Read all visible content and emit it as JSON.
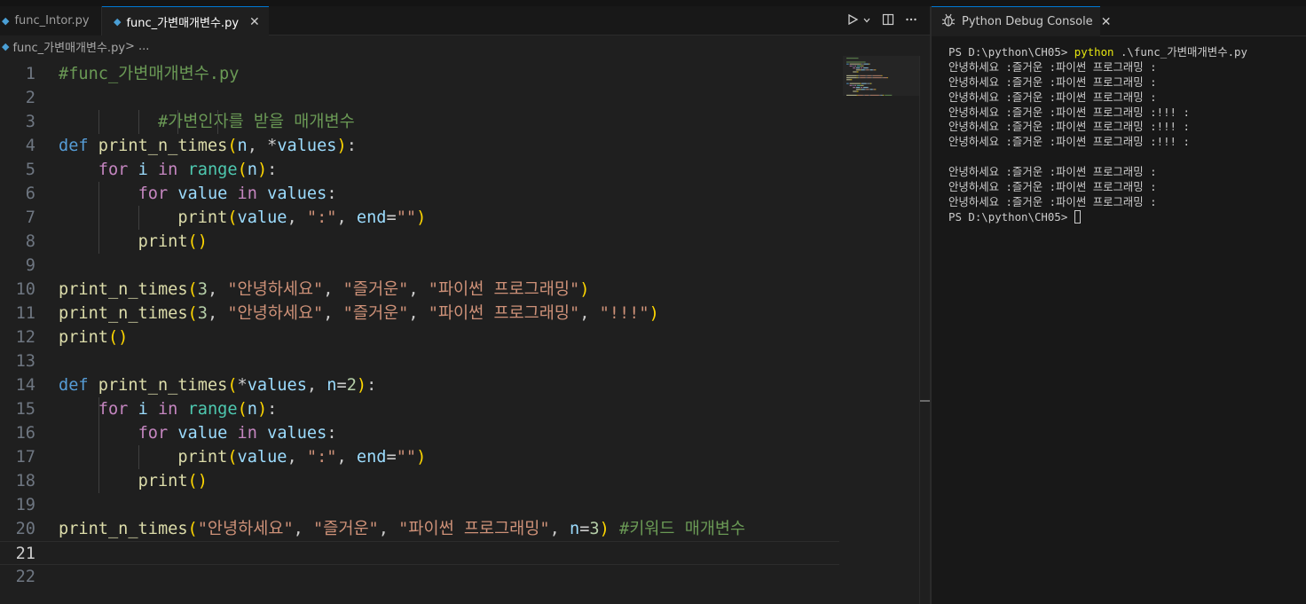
{
  "editor": {
    "tabs": [
      {
        "label": "func_Intor.py",
        "active": false
      },
      {
        "label": "func_가변매개변수.py",
        "active": true
      }
    ],
    "close_glyph": "✕",
    "breadcrumb": {
      "file": "func_가변매개변수.py",
      "rest": " > ..."
    },
    "actions": [
      "run-icon",
      "chevron-down-icon",
      "split-editor-icon",
      "more-icon"
    ],
    "active_line": 21,
    "lines": [
      [
        [
          "cmt",
          "#func_가변매개변수.py"
        ]
      ],
      [],
      [
        [
          "cmt",
          "          #가변인자를 받을 매개변수"
        ]
      ],
      [
        [
          "kw",
          "def"
        ],
        [
          "txt",
          " "
        ],
        [
          "fn",
          "print_n_times"
        ],
        [
          "p1",
          "("
        ],
        [
          "var",
          "n"
        ],
        [
          "txt",
          ", *"
        ],
        [
          "var",
          "values"
        ],
        [
          "p1",
          ")"
        ],
        [
          "txt",
          ":"
        ]
      ],
      [
        [
          "txt",
          "    "
        ],
        [
          "ctl",
          "for"
        ],
        [
          "txt",
          " "
        ],
        [
          "var",
          "i"
        ],
        [
          "txt",
          " "
        ],
        [
          "ctl",
          "in"
        ],
        [
          "txt",
          " "
        ],
        [
          "bi",
          "range"
        ],
        [
          "p1",
          "("
        ],
        [
          "var",
          "n"
        ],
        [
          "p1",
          ")"
        ],
        [
          "txt",
          ":"
        ]
      ],
      [
        [
          "txt",
          "        "
        ],
        [
          "ctl",
          "for"
        ],
        [
          "txt",
          " "
        ],
        [
          "var",
          "value"
        ],
        [
          "txt",
          " "
        ],
        [
          "ctl",
          "in"
        ],
        [
          "txt",
          " "
        ],
        [
          "var",
          "values"
        ],
        [
          "txt",
          ":"
        ]
      ],
      [
        [
          "txt",
          "            "
        ],
        [
          "fn",
          "print"
        ],
        [
          "p1",
          "("
        ],
        [
          "var",
          "value"
        ],
        [
          "txt",
          ", "
        ],
        [
          "str",
          "\":\""
        ],
        [
          "txt",
          ", "
        ],
        [
          "var",
          "end"
        ],
        [
          "txt",
          "="
        ],
        [
          "str",
          "\"\""
        ],
        [
          "p1",
          ")"
        ]
      ],
      [
        [
          "txt",
          "        "
        ],
        [
          "fn",
          "print"
        ],
        [
          "p1",
          "()"
        ]
      ],
      [],
      [
        [
          "fn",
          "print_n_times"
        ],
        [
          "p1",
          "("
        ],
        [
          "num",
          "3"
        ],
        [
          "txt",
          ", "
        ],
        [
          "str",
          "\"안녕하세요\""
        ],
        [
          "txt",
          ", "
        ],
        [
          "str",
          "\"즐거운\""
        ],
        [
          "txt",
          ", "
        ],
        [
          "str",
          "\"파이썬 프로그래밍\""
        ],
        [
          "p1",
          ")"
        ]
      ],
      [
        [
          "fn",
          "print_n_times"
        ],
        [
          "p1",
          "("
        ],
        [
          "num",
          "3"
        ],
        [
          "txt",
          ", "
        ],
        [
          "str",
          "\"안녕하세요\""
        ],
        [
          "txt",
          ", "
        ],
        [
          "str",
          "\"즐거운\""
        ],
        [
          "txt",
          ", "
        ],
        [
          "str",
          "\"파이썬 프로그래밍\""
        ],
        [
          "txt",
          ", "
        ],
        [
          "str",
          "\"!!!\""
        ],
        [
          "p1",
          ")"
        ]
      ],
      [
        [
          "fn",
          "print"
        ],
        [
          "p1",
          "()"
        ]
      ],
      [],
      [
        [
          "kw",
          "def"
        ],
        [
          "txt",
          " "
        ],
        [
          "fn",
          "print_n_times"
        ],
        [
          "p1",
          "("
        ],
        [
          "txt",
          "*"
        ],
        [
          "var",
          "values"
        ],
        [
          "txt",
          ", "
        ],
        [
          "var",
          "n"
        ],
        [
          "txt",
          "="
        ],
        [
          "num",
          "2"
        ],
        [
          "p1",
          ")"
        ],
        [
          "txt",
          ":"
        ]
      ],
      [
        [
          "txt",
          "    "
        ],
        [
          "ctl",
          "for"
        ],
        [
          "txt",
          " "
        ],
        [
          "var",
          "i"
        ],
        [
          "txt",
          " "
        ],
        [
          "ctl",
          "in"
        ],
        [
          "txt",
          " "
        ],
        [
          "bi",
          "range"
        ],
        [
          "p1",
          "("
        ],
        [
          "var",
          "n"
        ],
        [
          "p1",
          ")"
        ],
        [
          "txt",
          ":"
        ]
      ],
      [
        [
          "txt",
          "        "
        ],
        [
          "ctl",
          "for"
        ],
        [
          "txt",
          " "
        ],
        [
          "var",
          "value"
        ],
        [
          "txt",
          " "
        ],
        [
          "ctl",
          "in"
        ],
        [
          "txt",
          " "
        ],
        [
          "var",
          "values"
        ],
        [
          "txt",
          ":"
        ]
      ],
      [
        [
          "txt",
          "            "
        ],
        [
          "fn",
          "print"
        ],
        [
          "p1",
          "("
        ],
        [
          "var",
          "value"
        ],
        [
          "txt",
          ", "
        ],
        [
          "str",
          "\":\""
        ],
        [
          "txt",
          ", "
        ],
        [
          "var",
          "end"
        ],
        [
          "txt",
          "="
        ],
        [
          "str",
          "\"\""
        ],
        [
          "p1",
          ")"
        ]
      ],
      [
        [
          "txt",
          "        "
        ],
        [
          "fn",
          "print"
        ],
        [
          "p1",
          "()"
        ]
      ],
      [],
      [
        [
          "fn",
          "print_n_times"
        ],
        [
          "p1",
          "("
        ],
        [
          "str",
          "\"안녕하세요\""
        ],
        [
          "txt",
          ", "
        ],
        [
          "str",
          "\"즐거운\""
        ],
        [
          "txt",
          ", "
        ],
        [
          "str",
          "\"파이썬 프로그래밍\""
        ],
        [
          "txt",
          ", "
        ],
        [
          "var",
          "n"
        ],
        [
          "txt",
          "="
        ],
        [
          "num",
          "3"
        ],
        [
          "p1",
          ")"
        ],
        [
          "txt",
          " "
        ],
        [
          "cmt",
          "#키워드 매개변수"
        ]
      ],
      [],
      []
    ]
  },
  "console": {
    "tab_label": "Python Debug Console",
    "close_glyph": "✕",
    "prompt": "PS D:\\python\\CH05> ",
    "command": "python",
    "command_args": " .\\func_가변매개변수.py",
    "output": [
      "안녕하세요 :즐거운 :파이썬 프로그래밍 :",
      "안녕하세요 :즐거운 :파이썬 프로그래밍 :",
      "안녕하세요 :즐거운 :파이썬 프로그래밍 :",
      "안녕하세요 :즐거운 :파이썬 프로그래밍 :!!! :",
      "안녕하세요 :즐거운 :파이썬 프로그래밍 :!!! :",
      "안녕하세요 :즐거운 :파이썬 프로그래밍 :!!! :",
      "",
      "안녕하세요 :즐거운 :파이썬 프로그래밍 :",
      "안녕하세요 :즐거운 :파이썬 프로그래밍 :",
      "안녕하세요 :즐거운 :파이썬 프로그래밍 :"
    ],
    "final_prompt": "PS D:\\python\\CH05> "
  },
  "colors": {
    "editor_bg": "#1f1f1f",
    "panel_bg": "#181818",
    "accent": "#0078d4",
    "comment": "#6a9955",
    "keyword": "#569cd6",
    "control": "#c586c0",
    "function": "#dcdcaa",
    "variable": "#9cdcfe",
    "string": "#ce9178",
    "number": "#b5cea8",
    "builtin": "#4ec9b0",
    "bracket": "#ffd700",
    "command": "#e5e510"
  }
}
